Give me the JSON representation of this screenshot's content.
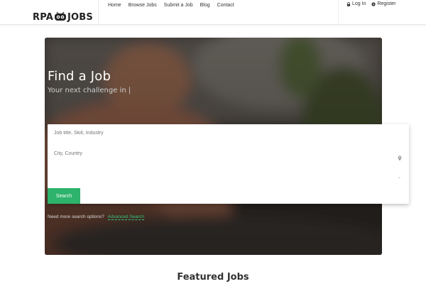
{
  "brand": {
    "left": "RPA",
    "right": "JOBS"
  },
  "nav": {
    "items": [
      "Home",
      "Browse Jobs",
      "Submit a Job",
      "Blog",
      "Contact"
    ]
  },
  "auth": {
    "login": "Log In",
    "register": "Register"
  },
  "hero": {
    "title": "Find a Job",
    "subtitle": "Your next challenge in",
    "cursor": "|"
  },
  "search": {
    "keyword_placeholder": "Job title, Skill, Industry",
    "location_placeholder": "City, Country",
    "button": "Search"
  },
  "more_options": {
    "text": "Need more search options?",
    "link": "Advanced Search"
  },
  "featured": {
    "title": "Featured Jobs"
  },
  "colors": {
    "accent": "#2db36b",
    "link": "#34c47a"
  },
  "icons": [
    "robot-logo-icon",
    "lock-icon",
    "gear-icon",
    "location-pin-icon",
    "chevron-down-icon"
  ]
}
